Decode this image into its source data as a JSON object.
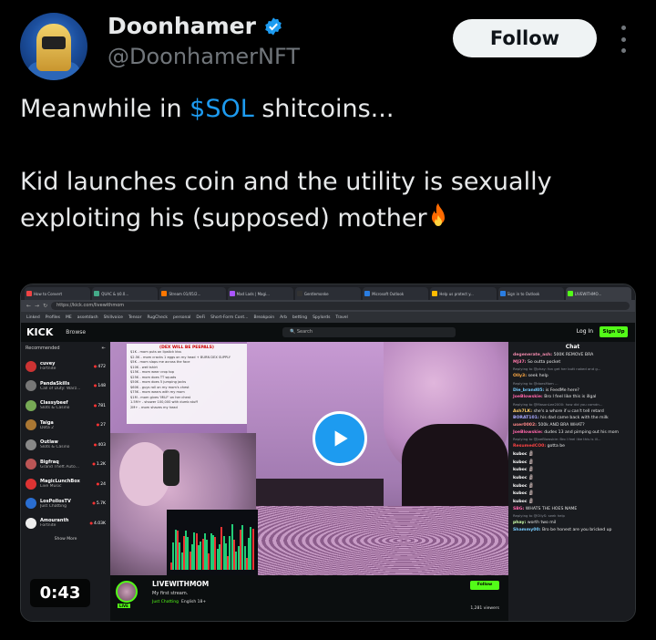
{
  "tweet": {
    "display_name": "Doonhamer",
    "handle": "@DoonhamerNFT",
    "follow_label": "Follow",
    "text_line1_prefix": "Meanwhile in ",
    "cashtag": "$SOL",
    "text_line1_suffix": " shitcoins...",
    "text_line2": "Kid launches coin and the utility is sexually",
    "text_line3": "exploiting his (supposed) mother",
    "video_duration": "0:43",
    "colors": {
      "cashtag": "#1d9bf0",
      "verified": "#1d9bf0",
      "play_button": "#1d9bf0"
    }
  },
  "browser": {
    "tabs": [
      {
        "label": "How to Convert",
        "color": "#e44"
      },
      {
        "label": "QUAC & $0.0...",
        "color": "#4a8"
      },
      {
        "label": "Stream 01/05/2...",
        "color": "#f70"
      },
      {
        "label": "Mad Lads | Magi...",
        "color": "#a5f"
      },
      {
        "label": "Gentlemonke",
        "color": "#333"
      },
      {
        "label": "Microsoft Outlook",
        "color": "#2a7de1"
      },
      {
        "label": "Help us protect y...",
        "color": "#fb0"
      },
      {
        "label": "Sign in to Outlook",
        "color": "#2a7de1"
      },
      {
        "label": "LIVEWITHMO...",
        "color": "#53fc18"
      }
    ],
    "url": "https://kick.com/livewithmom",
    "bookmarks": [
      "Linked",
      "Profiles",
      "ME",
      "assetdash",
      "Shillvoice",
      "Tensor",
      "RugCheck",
      "personal",
      "DeFi",
      "Short-Form Cont...",
      "Breakpoin",
      "Arb",
      "betting",
      "Spylords",
      "Travel"
    ]
  },
  "kick": {
    "logo": "KICK",
    "browse": "Browse",
    "search_placeholder": "Search",
    "login": "Log In",
    "signup": "Sign Up",
    "recommended": "Recommended",
    "show_more": "Show More",
    "channels": [
      {
        "name": "cuvey",
        "category": "Fortnite",
        "viewers": "472",
        "color": "#c33"
      },
      {
        "name": "PandaSkills",
        "category": "Call of Duty: Warz...",
        "viewers": "148",
        "color": "#777"
      },
      {
        "name": "Classybeef",
        "category": "Slots & Casino",
        "viewers": "781",
        "color": "#7a5"
      },
      {
        "name": "Taiga",
        "category": "Dota 2",
        "viewers": "27",
        "color": "#a73"
      },
      {
        "name": "Outlaw",
        "category": "Slots & Casino",
        "viewers": "403",
        "color": "#888"
      },
      {
        "name": "Bigfraq",
        "category": "Grand Theft Auto...",
        "viewers": "1.2K",
        "color": "#b55"
      },
      {
        "name": "MagicLunchBox",
        "category": "Live Music",
        "viewers": "24",
        "color": "#d33"
      },
      {
        "name": "LosPollosTV",
        "category": "Just Chatting",
        "viewers": "5.7K",
        "color": "#2a6ed1"
      },
      {
        "name": "Amouranth",
        "category": "Fortnite",
        "viewers": "4.03K",
        "color": "#eee"
      }
    ],
    "overlay": {
      "title": "(DEX WILL BE PEEPALS)",
      "lines": [
        "$1K - mom puts on lipstick kiss",
        "$2.5K - mom cracks 1 eggs on my head + BURN DEX SUPPLY",
        "$5K - mom slaps me across the face",
        "$10K - wet tshirt",
        "$15K - mom wear crop top",
        "$25K - mom does TT squats",
        "$50K - mom does 5 jumping jacks",
        "$60K - guys roll on my mom's chest",
        "$75K - mom wears with my mom",
        "$1M - mom gives 'MILF' on her chest",
        "1.5M+ - shower 100,000 with dumb stuff",
        "2M+ - mom shaves my head"
      ]
    },
    "stream": {
      "name": "LIVEWITHMOM",
      "title": "My first stream.",
      "category": "Just Chatting",
      "tags": "English   18+",
      "follow": "Follow",
      "viewers": "1,281 viewers",
      "live": "LIVE"
    },
    "chat_title": "Chat",
    "chat": [
      {
        "user": "degenerate_ash:",
        "text": "500K REMOVE BRA",
        "color": "#e8a"
      },
      {
        "user": "MJ37:",
        "text": "So outta pocket",
        "color": "#f7a"
      },
      {
        "user": "",
        "text": "Replying to @phay: fon get her butt naked and g...",
        "reply": true
      },
      {
        "user": "Olly3:",
        "text": "seek help",
        "color": "#fa4"
      },
      {
        "user": "",
        "text": "Replying to @doesMom ...",
        "reply": true
      },
      {
        "user": "Die_brand05:",
        "text": "is FeedMe here?",
        "color": "#7cf"
      },
      {
        "user": "JoeBlowskie:",
        "text": "Bro I feel like this is illgal",
        "color": "#f6a"
      },
      {
        "user": "",
        "text": "Replying to @MasonLee2000: how did you comdn...",
        "reply": true
      },
      {
        "user": "Ash7LK:",
        "text": "she's a whore if u can't tell retard",
        "color": "#fc6"
      },
      {
        "user": "BORAT101:",
        "text": "his dad came back with the milk",
        "color": "#aaf"
      },
      {
        "user": "user0002:",
        "text": "500k AND BRA WHAT?",
        "color": "#f88"
      },
      {
        "user": "JoeBlowskie:",
        "text": "dudes 13 and pimping out his mom",
        "color": "#f6a"
      },
      {
        "user": "",
        "text": "Replying to @JoeBlowskie: Bro I feel like this is ill...",
        "reply": true
      },
      {
        "user": "ResumedCO0:",
        "text": "gotta be",
        "color": "#f44"
      },
      {
        "user": "kuboc",
        "text": "",
        "color": "#fff"
      },
      {
        "user": "kuboc",
        "text": "",
        "color": "#fff"
      },
      {
        "user": "kuboc",
        "text": "",
        "color": "#fff"
      },
      {
        "user": "kuboc",
        "text": "",
        "color": "#fff"
      },
      {
        "user": "kuboc",
        "text": "",
        "color": "#fff"
      },
      {
        "user": "kuboc",
        "text": "",
        "color": "#fff"
      },
      {
        "user": "kuboc",
        "text": "",
        "color": "#fff"
      },
      {
        "user": "SBG:",
        "text": "WHATS THE HOES NAME",
        "color": "#f6a"
      },
      {
        "user": "",
        "text": "Replying to @OllyS: seek help",
        "reply": true
      },
      {
        "user": "phay:",
        "text": "worth two mil",
        "color": "#cfa"
      },
      {
        "user": "Shammy00:",
        "text": "Bro be honest are you bricked up",
        "color": "#7cf"
      }
    ]
  }
}
